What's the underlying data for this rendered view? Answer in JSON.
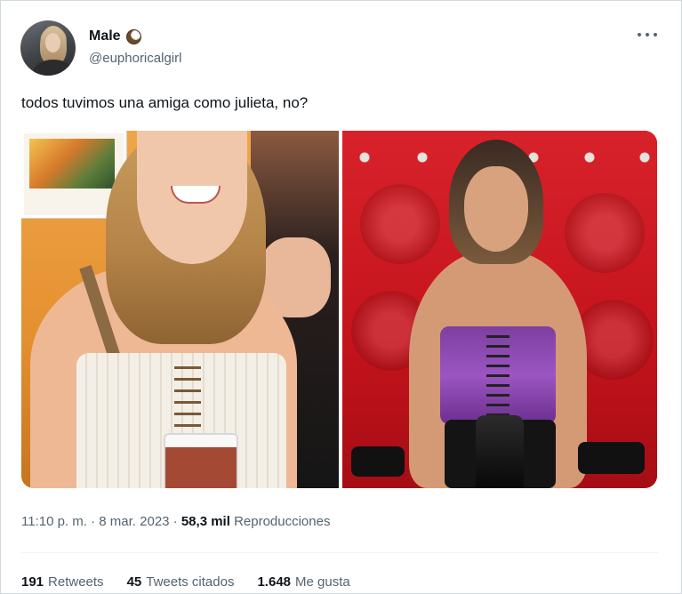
{
  "author": {
    "name": "Male",
    "name_emoji": "coconut-icon",
    "handle": "@euphoricalgirl"
  },
  "tweet": {
    "text": "todos tuvimos una amiga como julieta, no?"
  },
  "meta": {
    "time": "11:10 p. m.",
    "separator_1": " · ",
    "date": "8 mar. 2023",
    "separator_2": " · ",
    "views_count": "58,3 mil",
    "views_label": "Reproducciones"
  },
  "stats": {
    "retweets_count": "191",
    "retweets_label": "Retweets",
    "quotes_count": "45",
    "quotes_label": "Tweets citados",
    "likes_count": "1.648",
    "likes_label": "Me gusta"
  },
  "colors": {
    "text_primary": "#0f1419",
    "text_secondary": "#536471",
    "divider": "#eff3f4"
  }
}
